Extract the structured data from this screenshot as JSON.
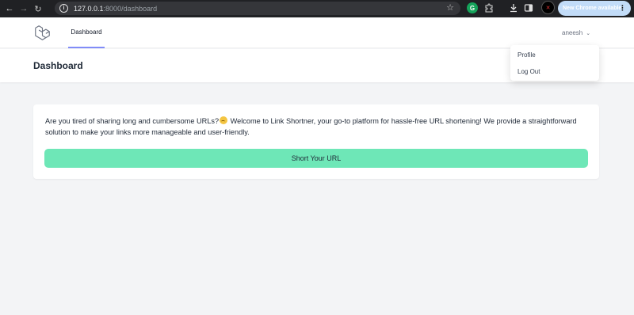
{
  "browser": {
    "url_host": "127.0.0.1",
    "url_rest": ":8000/dashboard",
    "update_label": "New Chrome available",
    "icons": [
      "back-arrow-icon",
      "forward-arrow-icon",
      "reload-icon",
      "info-icon",
      "star-icon",
      "grammarly-icon",
      "extensions-icon",
      "download-icon",
      "side-panel-icon",
      "profile-avatar-icon",
      "more-menu-icon"
    ]
  },
  "nav": {
    "dashboard_link": "Dashboard",
    "user_name": "aneesh"
  },
  "header": {
    "title": "Dashboard"
  },
  "dropdown": {
    "profile": "Profile",
    "logout": "Log Out"
  },
  "card": {
    "intro_before_emoji": "Are you tired of sharing long and cumbersome URLs?",
    "intro_after_emoji": " Welcome to Link Shortner, your go-to platform for hassle-free URL shortening! We provide a straightforward solution to make your links more manageable and user-friendly.",
    "button_label": "Short Your URL"
  },
  "colors": {
    "accent_green": "#6ee7b7",
    "nav_underline": "#818cf8",
    "page_bg": "#f3f4f6"
  }
}
